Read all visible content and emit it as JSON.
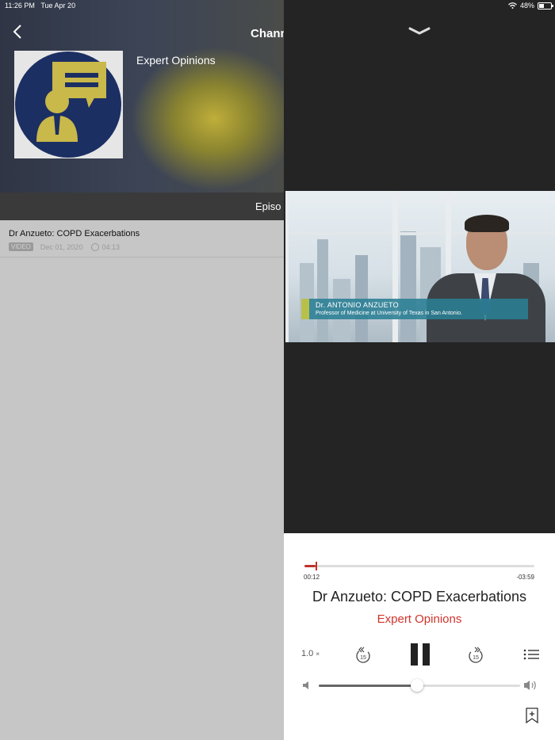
{
  "status_bar": {
    "time": "11:26 PM",
    "date": "Tue Apr 20",
    "battery": "48%"
  },
  "channel": {
    "title": "Chann",
    "name": "Expert Opinions",
    "tab": "Episo"
  },
  "episodes": [
    {
      "title": "Dr Anzueto: COPD Exacerbations",
      "badge": "VIDEO",
      "date": "Dec 01, 2020",
      "duration": "04:13"
    }
  ],
  "video": {
    "lower_third_name": "Dr. ANTONIO ANZUETO",
    "lower_third_role": "Professor of Medicine at University of Texas in San Antonio."
  },
  "player": {
    "elapsed": "00:12",
    "remaining": "-03:59",
    "progress": 0.048,
    "title": "Dr Anzueto: COPD Exacerbations",
    "channel": "Expert Opinions",
    "speed": "1.0",
    "speed_unit": "×",
    "skip_back": "15",
    "skip_forward": "15",
    "volume": 0.49
  },
  "colors": {
    "accent": "#d0342c",
    "player_bg": "#242424",
    "logo_blue": "#1c2f63",
    "logo_gold": "#c9b84a"
  }
}
